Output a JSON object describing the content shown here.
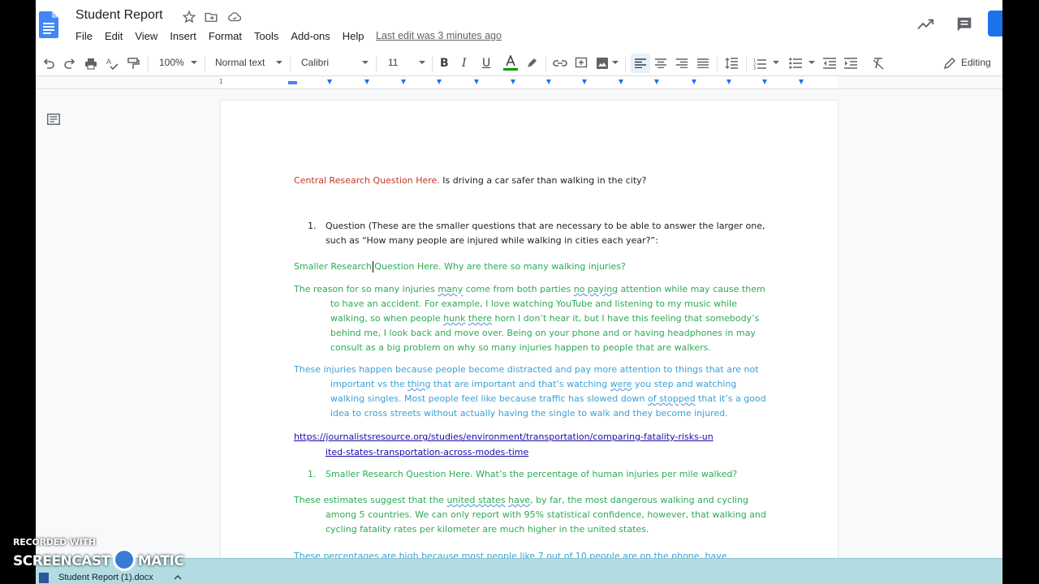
{
  "header": {
    "title": "Student Report",
    "menu": [
      "File",
      "Edit",
      "View",
      "Insert",
      "Format",
      "Tools",
      "Add-ons",
      "Help"
    ],
    "last_edit": "Last edit was 3 minutes ago"
  },
  "toolbar": {
    "zoom": "100%",
    "style": "Normal text",
    "font": "Calibri",
    "size": "11",
    "mode": "Editing"
  },
  "ruler": {
    "start": "1"
  },
  "document": {
    "central_label": "Central Research Question Here.",
    "central_question": "  Is driving a car safer than walking in the city?",
    "list1_num": "1.",
    "list1_line1": "Question (These are the smaller questions that are necessary to be able to answer the larger one,",
    "list1_line2": "such as “How many people are injured while walking in cities each year?”:",
    "smaller_q1": "Smaller Research Question Here. Why are there so many walking injuries?",
    "para1_l1a": "The reason for so many injuries ",
    "para1_l1b": "many",
    "para1_l1c": " come from both parties ",
    "para1_l1d": "no paying",
    "para1_l1e": " attention while may cause them",
    "para1_l2": "to have an accident. For example, I love watching YouTube and listening to my music while",
    "para1_l3a": "walking, so when people ",
    "para1_l3b": "hunk",
    "para1_l3c": " ",
    "para1_l3d": "there",
    "para1_l3e": " horn I don’t hear it, but I have this feeling that somebody’s",
    "para1_l4": "behind me, I look back and move over. Being on your phone and or having headphones in may",
    "para1_l5": "consult as a big problem on why so many injuries happen to people that are walkers.",
    "para2_l1": "These injuries happen because people become distracted and pay more attention to things that are not",
    "para2_l2a": "important vs the ",
    "para2_l2b": "thing",
    "para2_l2c": " that are important and that’s watching ",
    "para2_l2d": "were",
    "para2_l2e": " you step and watching",
    "para2_l3a": "walking singles. Most people feel like because traffic has slowed down ",
    "para2_l3b": "of stopped",
    "para2_l3c": " that it’s a good",
    "para2_l4": "idea to cross streets without actually having the single to walk and they become injured.",
    "link_l1": "https://journalistsresource.org/studies/environment/transportation/comparing-fatality-risks-un",
    "link_l2": "ited-states-transportation-across-modes-time",
    "list2_num": "1.",
    "list2_text": "Smaller Research Question Here. What’s the percentage of human injuries per mile walked?",
    "para3_l1a": "These estimates suggest that the ",
    "para3_l1b": "united states",
    "para3_l1c": " ",
    "para3_l1d": "have",
    "para3_l1e": ", by far, the most dangerous walking and cycling",
    "para3_l2": "among 5 countries. We can only report with 95% statistical confidence, however, that walking and",
    "para3_l3": "cycling fatality rates per kilometer are much higher in the united states.",
    "para4_l1": "These percentages are high because most people like 7 out of 10 people are on the phone, have"
  },
  "downloads": {
    "file": "Student Report (1).docx"
  },
  "watermark": {
    "top": "RECORDED WITH",
    "left": "SCREENCAST",
    "right": "MATIC"
  },
  "colors": {
    "red": "#c0392b",
    "green": "#2eaa54",
    "blue": "#3aa0d8",
    "accent": "#1a73e8"
  }
}
